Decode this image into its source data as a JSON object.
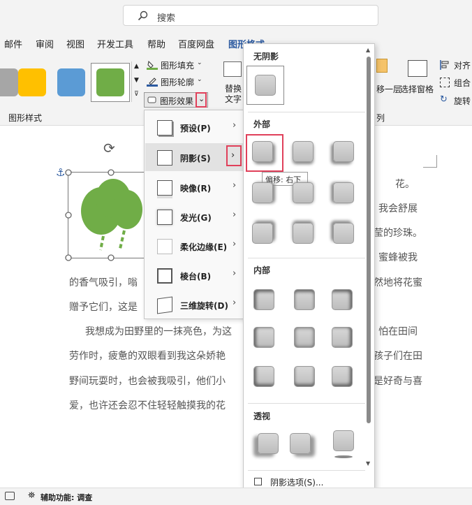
{
  "search": {
    "placeholder": "搜索"
  },
  "tabs": [
    "邮件",
    "审阅",
    "视图",
    "开发工具",
    "帮助",
    "百度网盘",
    "图形格式"
  ],
  "ribbon": {
    "fill": "图形填充",
    "outline": "图形轮廓",
    "effects": "图形效果",
    "group_styles": "图形样式",
    "alt_text1": "替换",
    "alt_text2": "文字",
    "forward": "移一层",
    "selection_pane": "选择窗格",
    "align": "对齐",
    "group": "组合",
    "rotate": "旋转",
    "arrange_tail": "列"
  },
  "colors": {
    "swatch_gray": "#a6a6a6",
    "swatch_yellow": "#ffc000",
    "swatch_blue": "#5b9bd5",
    "swatch_green": "#70ad47",
    "accent": "#2c5aa0",
    "highlight": "#e0405a"
  },
  "effects_menu": [
    {
      "label": "预设(P)",
      "icon": "preset-icon"
    },
    {
      "label": "阴影(S)",
      "icon": "shadow-icon"
    },
    {
      "label": "映像(R)",
      "icon": "reflection-icon"
    },
    {
      "label": "发光(G)",
      "icon": "glow-icon"
    },
    {
      "label": "柔化边缘(E)",
      "icon": "soft-edges-icon"
    },
    {
      "label": "棱台(B)",
      "icon": "bevel-icon"
    },
    {
      "label": "三维旋转(D)",
      "icon": "3d-rotation-icon"
    }
  ],
  "shadow_gallery": {
    "no_shadow": "无阴影",
    "outer": "外部",
    "inner": "内部",
    "perspective": "透视",
    "tooltip": "偏移: 右下",
    "options": "阴影选项(S)..."
  },
  "document": {
    "lines": [
      "花。",
      "我会舒展",
      "莹的珍珠。",
      "蜜蜂被我",
      "的香气吸引，嗡",
      "然地将花蜜",
      "赠予它们，这是",
      "我想成为田野里的一抹亮色，为这",
      "怕在田间",
      "劳作时，疲惫的双眼看到我这朵娇艳",
      "孩子们在田",
      "野间玩耍时，也会被我吸引，他们小",
      "是好奇与喜",
      "爱，也许还会忍不住轻轻触摸我的花"
    ]
  },
  "status": {
    "accessibility": "辅助功能: 调查"
  }
}
